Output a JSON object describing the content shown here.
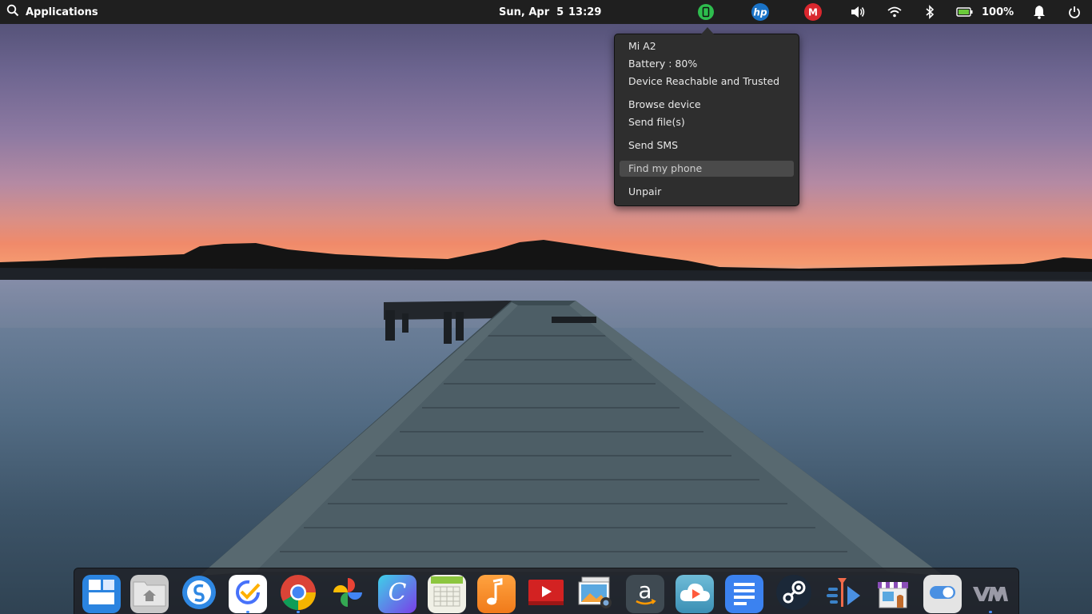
{
  "panel": {
    "applications_label": "Applications",
    "date": "Sun, Apr  5",
    "time": "13:29",
    "battery_percent": "100%",
    "tray_icons": [
      "kdeconnect-phone-icon",
      "hp-icon",
      "mega-icon",
      "volume-icon",
      "wifi-icon",
      "bluetooth-icon",
      "battery-icon",
      "notifications-bell-icon",
      "power-icon"
    ]
  },
  "popover": {
    "device_name": "Mi A2",
    "battery": "Battery : 80%",
    "status": "Device Reachable and Trusted",
    "browse": "Browse device",
    "send_files": "Send file(s)",
    "send_sms": "Send SMS",
    "find_phone": "Find my phone",
    "unpair": "Unpair"
  },
  "dock": {
    "apps": [
      "multitasking-view",
      "files",
      "simplenote",
      "ticktick",
      "chrome",
      "photos",
      "c-editor",
      "calendar",
      "music",
      "youtube",
      "image-viewer",
      "amazon",
      "cloud-player",
      "docs",
      "steam",
      "mail-send",
      "appcenter",
      "switchboard",
      "vmware"
    ]
  },
  "colors": {
    "panel_bg": "#1f1f1f",
    "popover_bg": "#2e2e2e",
    "accent": "#4a8fff"
  }
}
